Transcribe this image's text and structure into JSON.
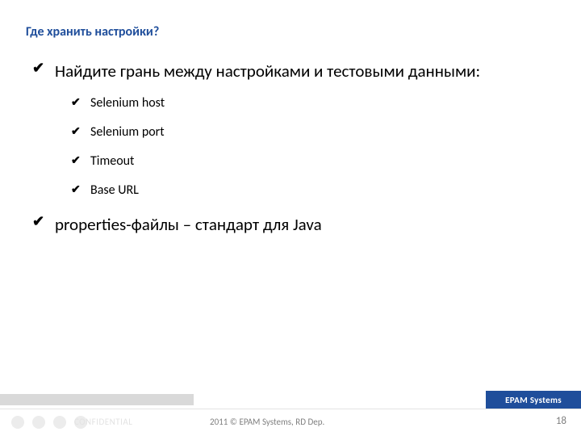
{
  "title": "Где хранить настройки?",
  "bullets": [
    {
      "text": "Найдите грань между настройками и тестовыми данными:",
      "sub": [
        "Selenium host",
        "Selenium port",
        "Timeout",
        "Base URL"
      ]
    },
    {
      "text": "properties-файлы – стандарт для Java",
      "sub": []
    }
  ],
  "footer": {
    "brand": "EPAM Systems",
    "faded": "CONFIDENTIAL",
    "copyright": "2011 © EPAM Systems, RD Dep.",
    "page": "18"
  }
}
